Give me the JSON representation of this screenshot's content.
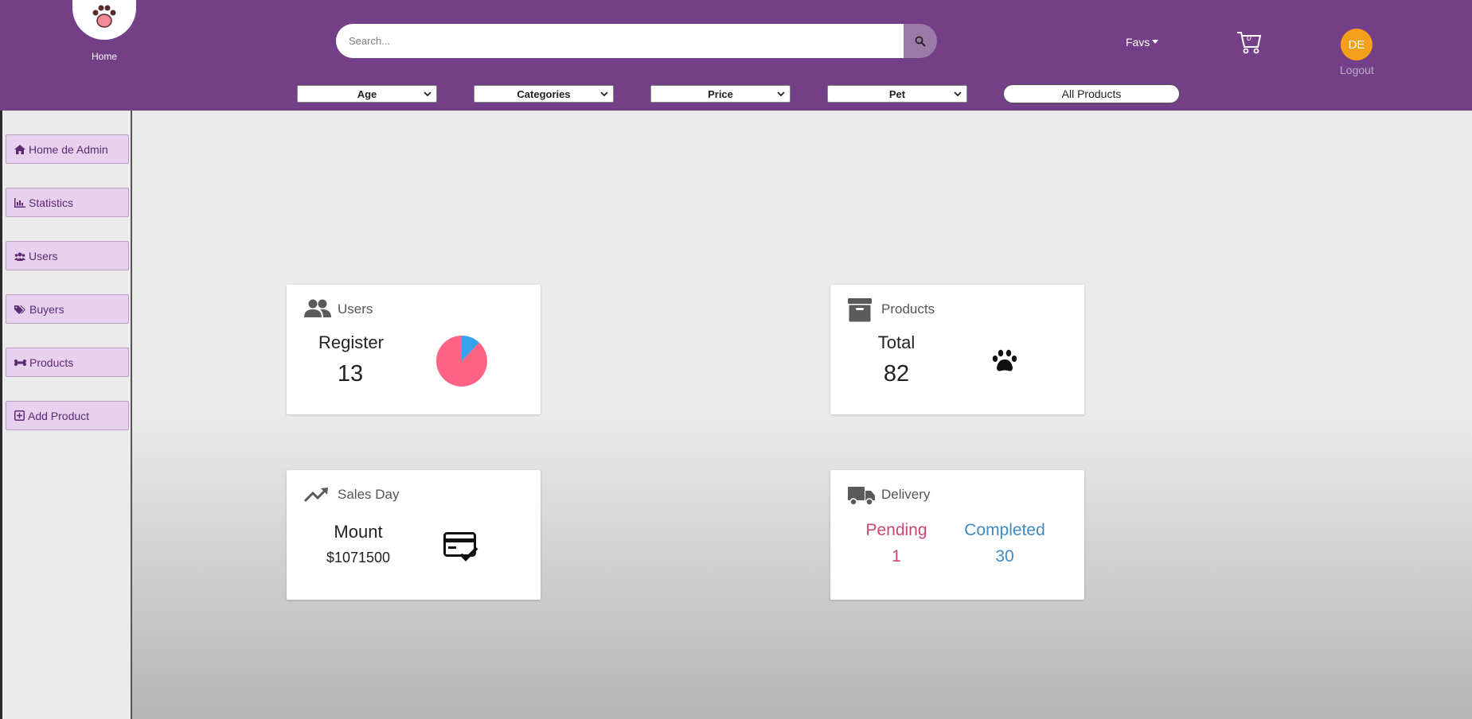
{
  "header": {
    "home_label": "Home",
    "search_placeholder": "Search...",
    "favs_label": "Favs",
    "cart_count": "0",
    "avatar_initials": "DE",
    "logout_label": "Logout",
    "brand_color": "#733f87"
  },
  "filters": {
    "age": "Age",
    "categories": "Categories",
    "price": "Price",
    "pet": "Pet",
    "all_products": "All Products"
  },
  "sidebar": {
    "items": [
      {
        "label": "Home de Admin",
        "icon": "home-icon"
      },
      {
        "label": "Statistics",
        "icon": "chart-icon"
      },
      {
        "label": "Users",
        "icon": "users-icon"
      },
      {
        "label": "Buyers",
        "icon": "tags-icon"
      },
      {
        "label": "Products",
        "icon": "bone-icon"
      },
      {
        "label": "Add Product",
        "icon": "plus-square-icon"
      }
    ]
  },
  "cards": {
    "users": {
      "title": "Users",
      "label": "Register",
      "value": "13"
    },
    "products": {
      "title": "Products",
      "label": "Total",
      "value": "82"
    },
    "sales": {
      "title": "Sales Day",
      "label": "Mount",
      "value": "$1071500"
    },
    "delivery": {
      "title": "Delivery",
      "pending_label": "Pending",
      "pending_value": "1",
      "completed_label": "Completed",
      "completed_value": "30",
      "pending_color": "#c9466e",
      "completed_color": "#3f8ac4"
    }
  },
  "chart_data": {
    "type": "pie",
    "series": [
      {
        "values": [
          88,
          12
        ]
      }
    ],
    "colors": [
      "#ff6384",
      "#36a2eb"
    ]
  }
}
